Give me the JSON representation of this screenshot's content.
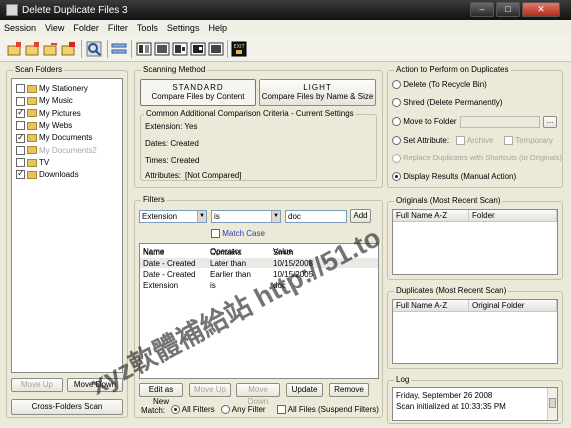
{
  "window": {
    "title": "Delete Duplicate Files 3",
    "min": "–",
    "max": "□",
    "close": "✕"
  },
  "menu": [
    "Session",
    "View",
    "Folder",
    "Filter",
    "Tools",
    "Settings",
    "Help"
  ],
  "toolbar_icons": [
    "new-session-icon",
    "add-folder-icon",
    "remove-folder-icon",
    "remove-all-folders-icon",
    "search-icon",
    "filter-icon",
    "files-icon",
    "copy-icon",
    "move-icon",
    "delete-icon",
    "exit-icon"
  ],
  "scan_folders": {
    "title": "Scan Folders",
    "items": [
      {
        "label": "My Stationery",
        "checked": false,
        "dim": false
      },
      {
        "label": "My Music",
        "checked": false,
        "dim": false
      },
      {
        "label": "My Pictures",
        "checked": true,
        "dim": false
      },
      {
        "label": "My Webs",
        "checked": false,
        "dim": false
      },
      {
        "label": "My Documents",
        "checked": true,
        "dim": false
      },
      {
        "label": "My Documents2",
        "checked": false,
        "dim": true
      },
      {
        "label": "TV",
        "checked": false,
        "dim": false
      },
      {
        "label": "Downloads",
        "checked": true,
        "dim": false
      }
    ],
    "move_up": "Move Up",
    "move_down": "Move Down",
    "cross_scan": "Cross-Folders Scan"
  },
  "scanning_method": {
    "title": "Scanning Method",
    "standard_title": "STANDARD",
    "standard_sub": "Compare Files by Content",
    "light_title": "LIGHT",
    "light_sub": "Compare Files by Name & Size",
    "criteria_title": "Common Additional Comparison Criteria - Current Settings",
    "extension": "Extension: Yes",
    "dates": "Dates: Created",
    "times": "Times: Created",
    "attributes": "Attributes:",
    "attributes_value": "[Not Compared]"
  },
  "filters": {
    "title": "Filters",
    "field": "Extension",
    "operator": "is",
    "value": "doc",
    "add": "Add",
    "match_case": "Match Case",
    "headers": [
      "Name",
      "Operator",
      "Value"
    ],
    "rows": [
      [
        "Name",
        "Contains",
        "Smith"
      ],
      [
        "Date - Created",
        "Later than",
        "10/15/2008"
      ],
      [
        "Date - Created",
        "Earlier than",
        "10/15/2005"
      ],
      [
        "Extension",
        "is",
        "doc"
      ]
    ],
    "edit_as_new": "Edit as New",
    "move_up": "Move Up",
    "move_down": "Move Down",
    "update": "Update",
    "remove": "Remove",
    "match_label": "Match:",
    "all_filters": "All Filters",
    "any_filter": "Any Filter",
    "all_files": "All Files (Suspend Filters)"
  },
  "action": {
    "title": "Action to Perform on Duplicates",
    "delete": "Delete (To Recycle Bin)",
    "shred": "Shred (Delete Permanently)",
    "move_to_folder": "Move to Folder",
    "browse": "...",
    "set_attribute": "Set Attribute:",
    "archive": "Archive",
    "temporary": "Temporary",
    "replace_shortcuts": "Replace Duplicates with Shortcuts (to Originals)",
    "display_results": "Display Results (Manual Action)"
  },
  "originals": {
    "title": "Originals (Most Recent Scan)",
    "col1": "Full Name A-Z",
    "col2": "Folder"
  },
  "duplicates": {
    "title": "Duplicates (Most Recent Scan)",
    "col1": "Full Name A-Z",
    "col2": "Original Folder"
  },
  "log": {
    "title": "Log",
    "line1": "Friday, September 26 2008",
    "line2": "Scan initialized at 10:33:35 PM"
  },
  "watermark": {
    "main": "xyz軟體補給站 http://51.to"
  }
}
